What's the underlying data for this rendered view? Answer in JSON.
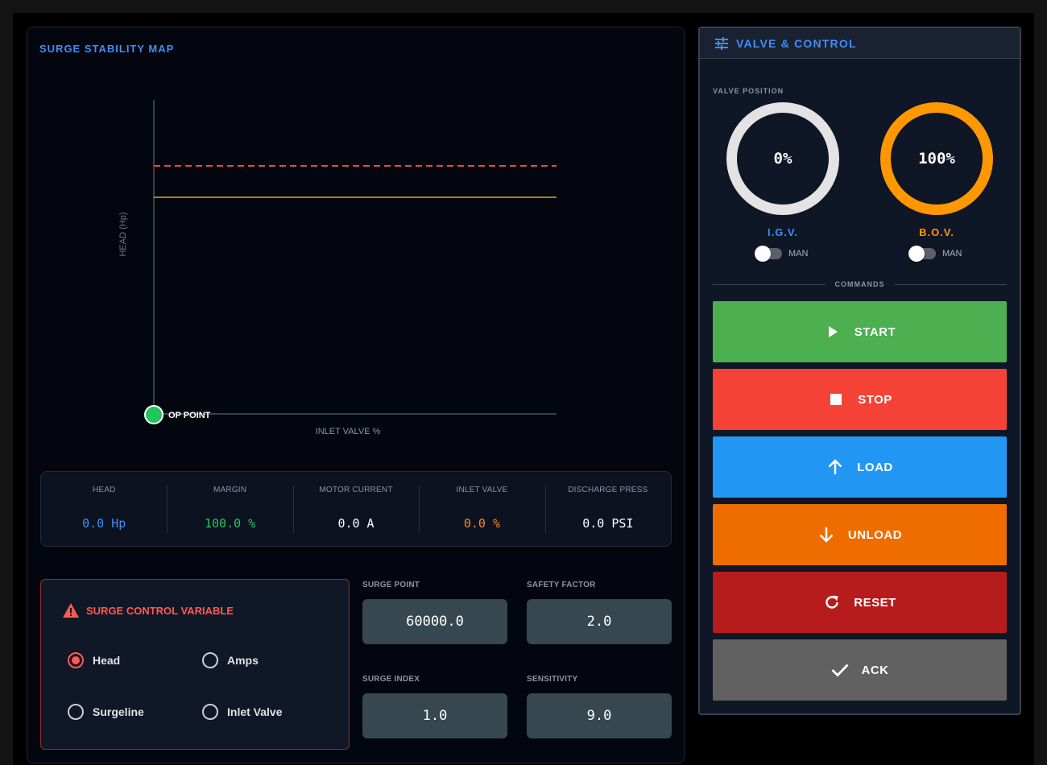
{
  "surge_map": {
    "title": "SURGE STABILITY MAP",
    "xlabel": "INLET VALVE %",
    "ylabel": "HEAD (Hp)",
    "op_point_label": "OP POINT"
  },
  "chart_data": {
    "type": "line",
    "title": "SURGE STABILITY MAP",
    "xlabel": "INLET VALVE %",
    "ylabel": "HEAD (Hp)",
    "series": [
      {
        "style": "dashed",
        "color": "#e5484d",
        "values": "constant horizontal line"
      },
      {
        "style": "solid",
        "color": "#e0a81c",
        "values": "constant horizontal line"
      }
    ],
    "points": [
      {
        "label": "OP POINT",
        "x": 0,
        "y": 0,
        "color": "#22c55e"
      }
    ],
    "grid": false
  },
  "stats": [
    {
      "label": "HEAD",
      "value": "0.0 Hp",
      "color": "#3f8ff7"
    },
    {
      "label": "MARGIN",
      "value": "100.0 %",
      "color": "#22c55e"
    },
    {
      "label": "MOTOR CURRENT",
      "value": "0.0 A",
      "color": "#ffffff"
    },
    {
      "label": "INLET VALVE",
      "value": "0.0 %",
      "color": "#f08a24"
    },
    {
      "label": "DISCHARGE PRESS",
      "value": "0.0 PSI",
      "color": "#ffffff"
    }
  ],
  "surge_control": {
    "title": "SURGE CONTROL VARIABLE",
    "options": [
      {
        "label": "Head",
        "checked": true
      },
      {
        "label": "Amps",
        "checked": false
      },
      {
        "label": "Surgeline",
        "checked": false
      },
      {
        "label": "Inlet Valve",
        "checked": false
      }
    ]
  },
  "fields": {
    "surge_point": {
      "label": "SURGE POINT",
      "value": "60000.0"
    },
    "safety_factor": {
      "label": "SAFETY FACTOR",
      "value": "2.0"
    },
    "surge_index": {
      "label": "SURGE INDEX",
      "value": "1.0"
    },
    "sensitivity": {
      "label": "SENSITIVITY",
      "value": "9.0"
    }
  },
  "valve_control": {
    "title": "VALVE & CONTROL",
    "icon": "sliders-icon",
    "position_label": "VALVE POSITION",
    "igv": {
      "value": "0%",
      "name": "I.G.V.",
      "mode": "MAN",
      "ring_color": "#e3e3e3",
      "name_color": "#3f8ff7",
      "level_percent": 0
    },
    "bov": {
      "value": "100%",
      "name": "B.O.V.",
      "mode": "MAN",
      "ring_color": "#ff9800",
      "name_color": "#ff9800",
      "level_percent": 100
    },
    "commands_label": "COMMANDS",
    "commands": [
      {
        "label": "START",
        "icon": "play-icon",
        "color": "#4caf50"
      },
      {
        "label": "STOP",
        "icon": "stop-icon",
        "color": "#f44336"
      },
      {
        "label": "LOAD",
        "icon": "arrow-up-icon",
        "color": "#2196f3"
      },
      {
        "label": "UNLOAD",
        "icon": "arrow-down-icon",
        "color": "#ef6c00"
      },
      {
        "label": "RESET",
        "icon": "refresh-icon",
        "color": "#b71c1c"
      },
      {
        "label": "ACK",
        "icon": "check-icon",
        "color": "#616161"
      }
    ]
  }
}
